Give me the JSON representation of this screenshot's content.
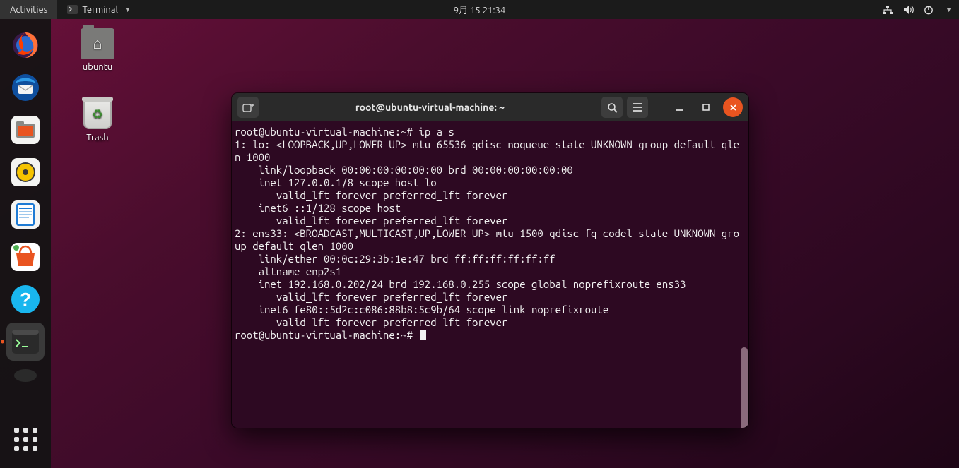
{
  "topbar": {
    "activities": "Activities",
    "app_label": "Terminal",
    "datetime": "9月 15  21:34"
  },
  "dock": {
    "apps": [
      {
        "name": "firefox",
        "color": "#ff7139"
      },
      {
        "name": "thunderbird",
        "color": "#1f6fd0"
      },
      {
        "name": "files",
        "bg": "#f5f5f4"
      },
      {
        "name": "rhythmbox",
        "bg": "#f5f5f4"
      },
      {
        "name": "writer",
        "bg": "#f5f5f4"
      },
      {
        "name": "software",
        "color": "#e95420"
      },
      {
        "name": "help",
        "color": "#19b6ee"
      },
      {
        "name": "terminal",
        "bg": "#2d2d2d"
      }
    ]
  },
  "desktop": {
    "icons": [
      {
        "name": "home-folder",
        "label": "ubuntu"
      },
      {
        "name": "trash",
        "label": "Trash"
      }
    ]
  },
  "terminal": {
    "title": "root@ubuntu-virtual-machine: ~",
    "prompt1": "root@ubuntu-virtual-machine:~#",
    "command1": "ip a s",
    "output": "1: lo: <LOOPBACK,UP,LOWER_UP> mtu 65536 qdisc noqueue state UNKNOWN group default qlen 1000\n    link/loopback 00:00:00:00:00:00 brd 00:00:00:00:00:00\n    inet 127.0.0.1/8 scope host lo\n       valid_lft forever preferred_lft forever\n    inet6 ::1/128 scope host \n       valid_lft forever preferred_lft forever\n2: ens33: <BROADCAST,MULTICAST,UP,LOWER_UP> mtu 1500 qdisc fq_codel state UNKNOWN group default qlen 1000\n    link/ether 00:0c:29:3b:1e:47 brd ff:ff:ff:ff:ff:ff\n    altname enp2s1\n    inet 192.168.0.202/24 brd 192.168.0.255 scope global noprefixroute ens33\n       valid_lft forever preferred_lft forever\n    inet6 fe80::5d2c:c086:88b8:5c9b/64 scope link noprefixroute \n       valid_lft forever preferred_lft forever",
    "prompt2": "root@ubuntu-virtual-machine:~#"
  }
}
